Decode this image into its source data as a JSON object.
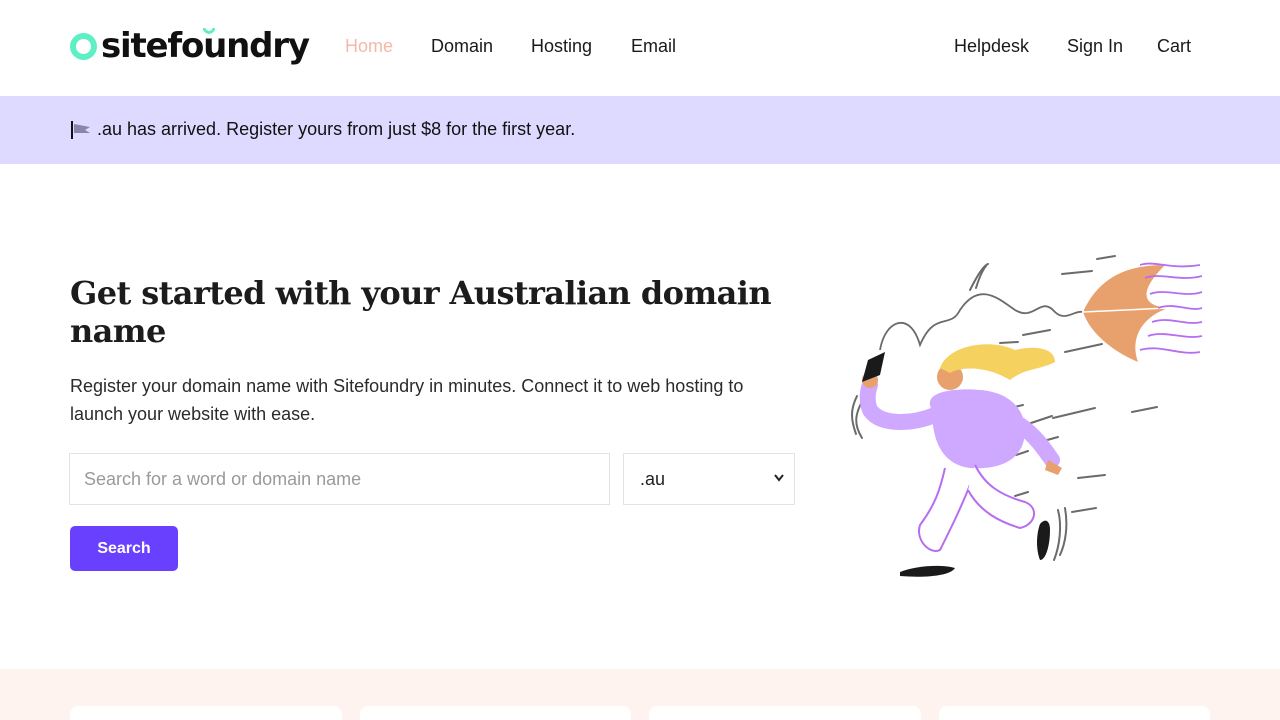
{
  "brand": {
    "name": "sitefoundry",
    "accent_color": "#5ef0c4"
  },
  "nav": {
    "primary": [
      {
        "label": "Home",
        "active": true
      },
      {
        "label": "Domain",
        "active": false
      },
      {
        "label": "Hosting",
        "active": false
      },
      {
        "label": "Email",
        "active": false
      }
    ],
    "secondary": [
      {
        "label": "Helpdesk"
      },
      {
        "label": "Sign In"
      },
      {
        "label": "Cart"
      }
    ]
  },
  "banner": {
    "icon": "flag-icon",
    "text": ".au has arrived. Register yours from just $8 for the first year.",
    "background": "#ddd9ff"
  },
  "hero": {
    "title": "Get started with your Australian domain name",
    "description": "Register your domain name with Sitefoundry in minutes. Connect it to web hosting to launch your website with ease.",
    "search_placeholder": "Search for a word or domain name",
    "search_value": "",
    "tld_selected": ".au",
    "search_button": "Search",
    "button_color": "#6a40ff"
  },
  "illustration": {
    "icon": "woman-with-umbrella-in-wind-illustration"
  },
  "features_section": {
    "background": "#fff3ef",
    "cards_visible": 4
  }
}
